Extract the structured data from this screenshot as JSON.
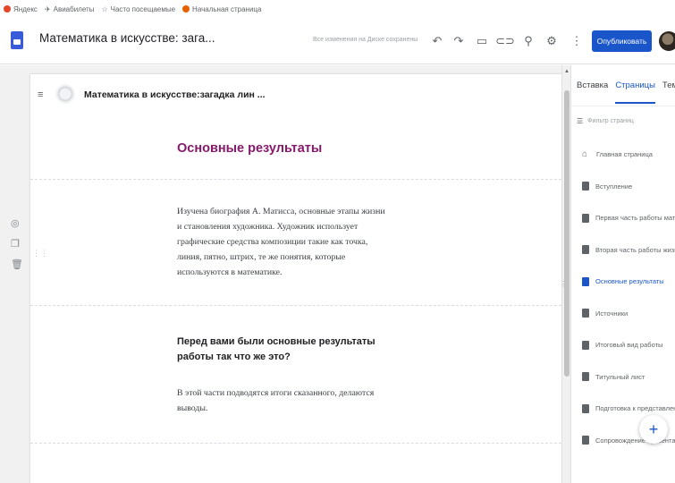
{
  "bookmarks": [
    {
      "label": "Яндекс",
      "icon": "yandex-icon",
      "color": "#e5462a"
    },
    {
      "label": "Авиабилеты",
      "icon": "plane-icon",
      "color": "#5f6368"
    },
    {
      "label": "Часто посещаемые",
      "icon": "star-icon",
      "color": "#5f6368"
    },
    {
      "label": "Начальная страница",
      "icon": "firefox-icon",
      "color": "#e66000"
    }
  ],
  "app": {
    "doc_title": "Математика в искусстве: зага...",
    "save_status": "Все изменения на Диске сохранены",
    "publish_label": "Опубликовать",
    "toolbar_icons": [
      "undo-icon",
      "redo-icon",
      "preview-icon",
      "link-icon",
      "add-person-icon",
      "settings-icon",
      "more-icon"
    ]
  },
  "site": {
    "name": "Математика в искусстве:загадка лин ...",
    "heading": "Основные результаты",
    "body1": "Изучена биография А. Матисса, основные этапы жизни и становления художника.  Художник использует графические средства композиции такие как точка, линия, пятно, штрих, те же понятия, которые используются в математике.",
    "subheading": "Перед вами были основные результаты работы так что же это?",
    "body2": "В этой части подводятся итоги сказанного, делаются выводы."
  },
  "panel": {
    "tabs": [
      "Вставка",
      "Страницы",
      "Темы"
    ],
    "active_tab": 1,
    "filter_placeholder": "Фильтр страниц",
    "pages": [
      {
        "label": "Главная страница",
        "icon": "home-icon"
      },
      {
        "label": "Вступление",
        "icon": "page-icon"
      },
      {
        "label": "Первая часть работы мате...",
        "icon": "page-icon"
      },
      {
        "label": "Вторая часть работы жизн...",
        "icon": "page-icon"
      },
      {
        "label": "Основные результаты",
        "icon": "page-icon",
        "active": true
      },
      {
        "label": "Источники",
        "icon": "page-icon"
      },
      {
        "label": "Итоговый вид работы",
        "icon": "page-icon"
      },
      {
        "label": "Титульный лист",
        "icon": "page-icon"
      },
      {
        "label": "Подготовка к представлен...",
        "icon": "page-icon"
      },
      {
        "label": "Сопровождение презентац...",
        "icon": "page-icon"
      }
    ]
  },
  "colors": {
    "accent": "#1a56c9",
    "heading": "#86196b"
  }
}
